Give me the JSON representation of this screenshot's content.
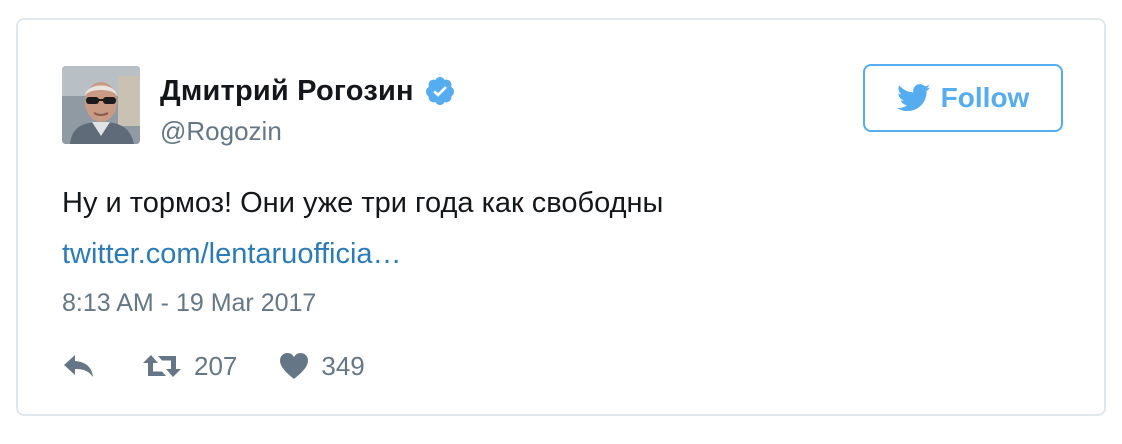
{
  "tweet": {
    "author": {
      "display_name": "Дмитрий Рогозин",
      "handle": "@Rogozin",
      "verified_icon": "verified-badge-icon",
      "avatar": "profile-photo"
    },
    "follow_button": {
      "label": "Follow",
      "icon": "twitter-bird-icon"
    },
    "text": "Ну и тормоз! Они уже три года как свободны",
    "link": "twitter.com/lentaruofficia…",
    "timestamp": "8:13 AM - 19 Mar 2017",
    "actions": {
      "reply": {
        "icon": "reply-icon"
      },
      "retweet": {
        "icon": "retweet-icon",
        "count": "207"
      },
      "like": {
        "icon": "heart-icon",
        "count": "349"
      }
    }
  },
  "colors": {
    "brand_blue": "#55acee",
    "link_blue": "#2b7bb9",
    "text_dark": "#14171a",
    "text_gray": "#657786",
    "border": "#e1e8ed"
  }
}
